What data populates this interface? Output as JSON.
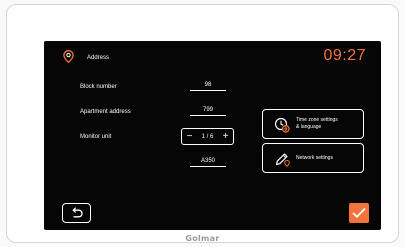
{
  "header": {
    "title": "Address",
    "time": "09:27",
    "icon": "location-pin-icon"
  },
  "form": {
    "block_number": {
      "label": "Block number",
      "value": "98"
    },
    "apartment_address": {
      "label": "Apartment address",
      "value": "799"
    },
    "monitor_unit": {
      "label": "Monitor unit",
      "minus": "−",
      "plus": "+",
      "value": "1 / 6"
    },
    "model": {
      "value": "A350"
    }
  },
  "settings": {
    "time_zone": {
      "line1": "Time zone settings",
      "line2": "& language",
      "icon": "clock-globe-icon"
    },
    "network": {
      "label": "Network settings",
      "icon": "pencil-settings-icon"
    }
  },
  "footer": {
    "back_icon": "back-arrow-icon",
    "confirm_icon": "checkmark-icon",
    "brand": "Golmar"
  },
  "colors": {
    "accent": "#f3733d",
    "screen_bg": "#060606",
    "text": "#ffffff"
  }
}
